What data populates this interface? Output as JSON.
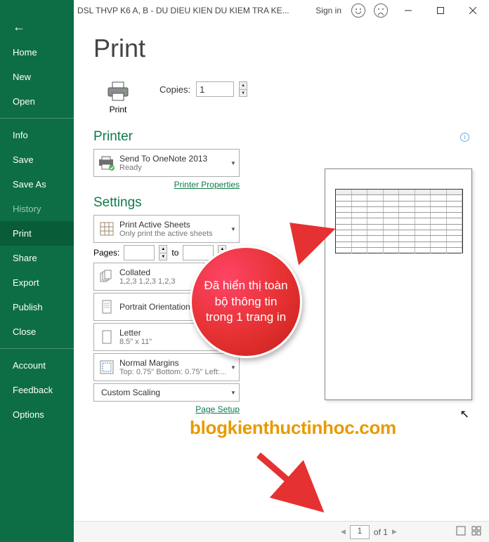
{
  "titlebar": {
    "title": "DSL THVP K6 A, B - DU DIEU KIEN DU KIEM TRA KE...",
    "sign_in": "Sign in"
  },
  "sidebar": {
    "home": "Home",
    "new": "New",
    "open": "Open",
    "info": "Info",
    "save": "Save",
    "save_as": "Save As",
    "history": "History",
    "print": "Print",
    "share": "Share",
    "export": "Export",
    "publish": "Publish",
    "close": "Close",
    "account": "Account",
    "feedback": "Feedback",
    "options": "Options"
  },
  "page": {
    "title": "Print",
    "print_button": "Print",
    "copies_label": "Copies:",
    "copies_value": "1"
  },
  "printer": {
    "header": "Printer",
    "name": "Send To OneNote 2013",
    "status": "Ready",
    "properties_link": "Printer Properties"
  },
  "settings": {
    "header": "Settings",
    "active_sheets": {
      "line1": "Print Active Sheets",
      "line2": "Only print the active sheets"
    },
    "pages_label": "Pages:",
    "pages_to": "to",
    "collated": {
      "line1": "Collated",
      "line2": "1,2,3   1,2,3   1,2,3"
    },
    "orientation": {
      "line1": "Portrait Orientation"
    },
    "paper": {
      "line1": "Letter",
      "line2": "8.5\" x 11\""
    },
    "margins": {
      "line1": "Normal Margins",
      "line2": "Top: 0.75\" Bottom: 0.75\" Left:..."
    },
    "scaling": {
      "line1": "Custom Scaling"
    },
    "page_setup_link": "Page Setup"
  },
  "footer": {
    "current_page": "1",
    "of": "of 1"
  },
  "annotation": {
    "callout_text": "Đã hiển thị toàn bộ thông tin trong 1 trang in",
    "watermark": "blogkienthuctinhoc.com"
  }
}
